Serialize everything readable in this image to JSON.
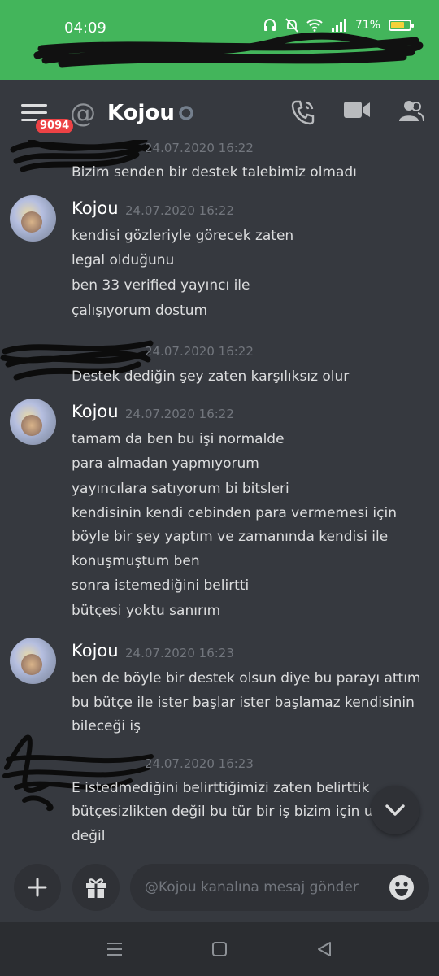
{
  "status_bar": {
    "time": "04:09",
    "battery": "71%",
    "battery_level": 0.71
  },
  "header": {
    "badge": "9094",
    "channel_name": "Kojou",
    "actions": [
      "call-icon",
      "video-icon",
      "members-icon"
    ]
  },
  "messages": [
    {
      "author": "",
      "timestamp": "24.07.2020 16:22",
      "lines": [
        "Bizim senden bir destek talebimiz olmadı"
      ]
    },
    {
      "author": "Kojou",
      "timestamp": "24.07.2020 16:22",
      "lines": [
        "kendisi gözleriyle görecek zaten",
        "legal olduğunu",
        "ben 33 verified yayıncı ile",
        "çalışıyorum dostum"
      ]
    },
    {
      "author": "",
      "timestamp": "24.07.2020 16:22",
      "lines": [
        "Destek dediğin şey zaten karşılıksız olur"
      ]
    },
    {
      "author": "Kojou",
      "timestamp": "24.07.2020 16:22",
      "lines": [
        "tamam da ben bu işi normalde",
        "para almadan yapmıyorum",
        "yayıncılara satıyorum bi bitsleri",
        "kendisinin kendi cebinden para vermemesi için",
        "böyle bir şey yaptım ve zamanında kendisi ile",
        "konuşmuştum ben",
        "sonra istemediğini belirtti",
        "bütçesi yoktu sanırım"
      ]
    },
    {
      "author": "Kojou",
      "timestamp": "24.07.2020 16:23",
      "lines": [
        "ben de böyle bir destek olsun diye bu parayı attım",
        "bu bütçe ile ister başlar ister başlamaz kendisinin",
        "bileceği iş"
      ]
    },
    {
      "author": "",
      "timestamp": "24.07.2020 16:23",
      "lines": [
        "E istedmediğini belirttiğimizi zaten belirttik",
        "bütçesizlikten değil bu tür bir iş bizim için u",
        "değil"
      ]
    }
  ],
  "composer": {
    "placeholder": "@Kojou kanalına mesaj gönder"
  },
  "colors": {
    "status_bar": "#43b55b",
    "background": "#36393f",
    "badge": "#ed4245"
  }
}
